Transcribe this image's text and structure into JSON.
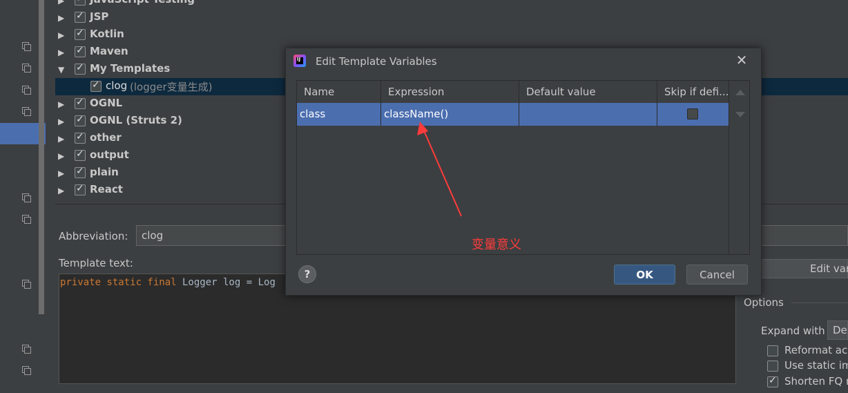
{
  "tree": {
    "items": [
      {
        "label": "JavaScript Testing",
        "expanded": false
      },
      {
        "label": "JSP",
        "expanded": false
      },
      {
        "label": "Kotlin",
        "expanded": false
      },
      {
        "label": "Maven",
        "expanded": false
      },
      {
        "label": "My Templates",
        "expanded": true
      },
      {
        "label": "clog",
        "desc": "(logger变量生成)",
        "child": true,
        "selected": true
      },
      {
        "label": "OGNL",
        "expanded": false
      },
      {
        "label": "OGNL (Struts 2)",
        "expanded": false
      },
      {
        "label": "other",
        "expanded": false
      },
      {
        "label": "output",
        "expanded": false
      },
      {
        "label": "plain",
        "expanded": false
      },
      {
        "label": "React",
        "expanded": false
      }
    ]
  },
  "abbreviation": {
    "label": "Abbreviation:",
    "value": "clog"
  },
  "template_text": {
    "label": "Template text:",
    "keywords": "private static final",
    "rest": " Logger log = Log"
  },
  "edit_variables_label": "Edit vari",
  "options": {
    "title": "Options",
    "expand_label": "Expand with",
    "expand_value": "De",
    "checkboxes": [
      {
        "label": "Reformat acc",
        "checked": false
      },
      {
        "label": "Use static im",
        "checked": false
      },
      {
        "label": "Shorten FQ n",
        "checked": true
      }
    ]
  },
  "dialog": {
    "title": "Edit Template Variables",
    "logo_text": "IJ",
    "close_glyph": "✕",
    "columns": [
      "Name",
      "Expression",
      "Default value",
      "Skip if defi..."
    ],
    "rows": [
      {
        "name": "class",
        "expression": "className()",
        "default": "",
        "skip": false
      }
    ],
    "help_label": "?",
    "ok_label": "OK",
    "cancel_label": "Cancel"
  },
  "annotation": {
    "text": "变量意义",
    "color": "#ff3b3b"
  },
  "colors": {
    "selection": "#4b6eaf",
    "keyword": "#cc7832",
    "background": "#3c3f41"
  }
}
